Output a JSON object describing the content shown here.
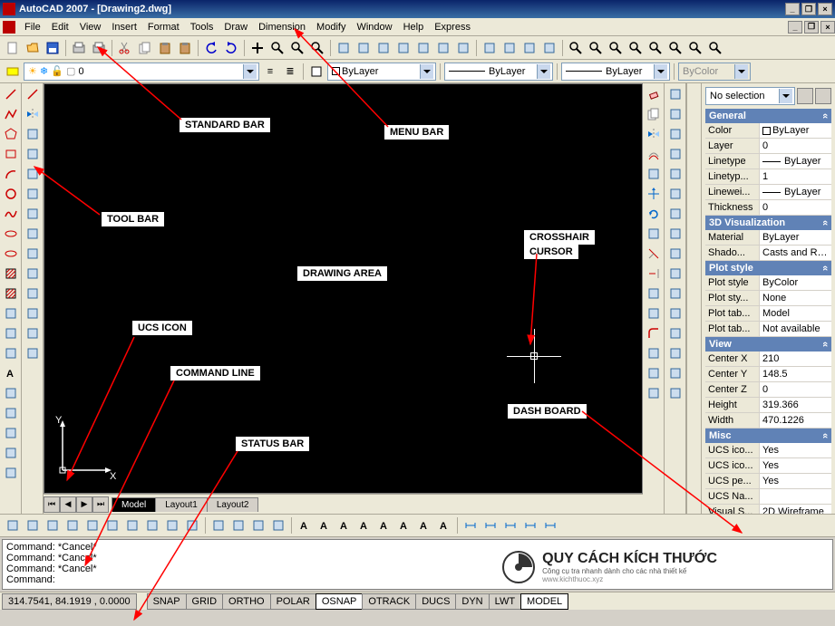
{
  "title": "AutoCAD 2007 - [Drawing2.dwg]",
  "menus": [
    "File",
    "Edit",
    "View",
    "Insert",
    "Format",
    "Tools",
    "Draw",
    "Dimension",
    "Modify",
    "Window",
    "Help",
    "Express"
  ],
  "layer_dropdown": "0",
  "bylayer": "ByLayer",
  "bycolor": "ByColor",
  "tabs": [
    "Model",
    "Layout1",
    "Layout2"
  ],
  "props_sel": "No selection",
  "sections": {
    "general": {
      "title": "General",
      "rows": [
        {
          "k": "Color",
          "v": "ByLayer",
          "swatch": true
        },
        {
          "k": "Layer",
          "v": "0"
        },
        {
          "k": "Linetype",
          "v": "ByLayer",
          "line": true
        },
        {
          "k": "Linetyp...",
          "v": "1"
        },
        {
          "k": "Linewei...",
          "v": "ByLayer",
          "line": true
        },
        {
          "k": "Thickness",
          "v": "0"
        }
      ]
    },
    "viz": {
      "title": "3D Visualization",
      "rows": [
        {
          "k": "Material",
          "v": "ByLayer"
        },
        {
          "k": "Shado...",
          "v": "Casts and Rec..."
        }
      ]
    },
    "plot": {
      "title": "Plot style",
      "rows": [
        {
          "k": "Plot style",
          "v": "ByColor"
        },
        {
          "k": "Plot sty...",
          "v": "None"
        },
        {
          "k": "Plot tab...",
          "v": "Model"
        },
        {
          "k": "Plot tab...",
          "v": "Not available"
        }
      ]
    },
    "view": {
      "title": "View",
      "rows": [
        {
          "k": "Center X",
          "v": "210"
        },
        {
          "k": "Center Y",
          "v": "148.5"
        },
        {
          "k": "Center Z",
          "v": "0"
        },
        {
          "k": "Height",
          "v": "319.366"
        },
        {
          "k": "Width",
          "v": "470.1226"
        }
      ]
    },
    "misc": {
      "title": "Misc",
      "rows": [
        {
          "k": "UCS ico...",
          "v": "Yes"
        },
        {
          "k": "UCS ico...",
          "v": "Yes"
        },
        {
          "k": "UCS pe...",
          "v": "Yes"
        },
        {
          "k": "UCS Na...",
          "v": ""
        },
        {
          "k": "Visual S...",
          "v": "2D Wireframe"
        }
      ]
    }
  },
  "cmd": [
    "Command: *Cancel*",
    "Command: *Cancel*",
    "Command: *Cancel*",
    "Command:"
  ],
  "coords": "314.7541, 84.1919 , 0.0000",
  "status_btns": [
    "SNAP",
    "GRID",
    "ORTHO",
    "POLAR",
    "OSNAP",
    "OTRACK",
    "DUCS",
    "DYN",
    "LWT",
    "MODEL"
  ],
  "status_active": [
    "OSNAP",
    "MODEL"
  ],
  "labels": {
    "standard": "STANDARD BAR",
    "menu": "MENU BAR",
    "tool": "TOOL BAR",
    "crosshair_l": "CROSSHAIR",
    "cursor_l": "CURSOR",
    "drawing": "DRAWING AREA",
    "ucs": "UCS ICON",
    "cmd": "COMMAND LINE",
    "status": "STATUS BAR",
    "dash": "DASH BOARD"
  },
  "watermark": {
    "t1": "QUY CÁCH KÍCH THƯỚC",
    "t2": "Công cụ tra nhanh dành cho các nhà thiết kế",
    "t3": "www.kichthuoc.xyz"
  }
}
